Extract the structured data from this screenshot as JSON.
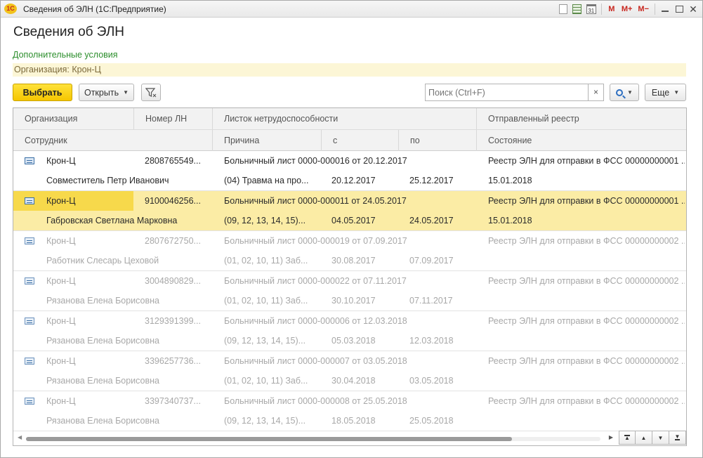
{
  "window": {
    "title": "Сведения об ЭЛН  (1С:Предприятие)",
    "logo_text": "1С",
    "calendar_day": "31",
    "memory_buttons": [
      "M",
      "M+",
      "M−"
    ]
  },
  "form": {
    "title": "Сведения об ЭЛН",
    "extra_conditions": "Дополнительные условия",
    "org_filter": "Организация: Крон-Ц"
  },
  "toolbar": {
    "select_label": "Выбрать",
    "open_label": "Открыть",
    "more_label": "Еще",
    "clear_glyph": "×"
  },
  "search": {
    "placeholder": "Поиск (Ctrl+F)",
    "value": ""
  },
  "table": {
    "header_row1": [
      "Организация",
      "Номер ЛН",
      "Листок нетрудоспособности",
      "Отправленный реестр"
    ],
    "header_row2": [
      "Сотрудник",
      "Причина",
      "с",
      "по",
      "Состояние"
    ],
    "rows": [
      {
        "org": "Крон-Ц",
        "number": "2808765549...",
        "sheet": "Больничный лист 0000-000016 от 20.12.2017",
        "registry": "Реестр ЭЛН для отправки в ФСС 00000000001 ...",
        "employee": "Совместитель Петр Иванович",
        "reason": "(04) Травма на про...",
        "from": "20.12.2017",
        "to": "25.12.2017",
        "state": "15.01.2018",
        "status": "active"
      },
      {
        "org": "Крон-Ц",
        "number": "9100046256...",
        "sheet": "Больничный лист 0000-000011 от 24.05.2017",
        "registry": "Реестр ЭЛН для отправки в ФСС 00000000001 ...",
        "employee": "Габровская Светлана Марковна",
        "reason": "(09, 12, 13, 14, 15)...",
        "from": "04.05.2017",
        "to": "24.05.2017",
        "state": "15.01.2018",
        "status": "selected"
      },
      {
        "org": "Крон-Ц",
        "number": "2807672750...",
        "sheet": "Больничный лист 0000-000019 от 07.09.2017",
        "registry": "Реестр ЭЛН для отправки в ФСС 00000000002 ...",
        "employee": "Работник Слесарь Цеховой",
        "reason": "(01, 02, 10, 11) Заб...",
        "from": "30.08.2017",
        "to": "07.09.2017",
        "state": "",
        "status": "dim"
      },
      {
        "org": "Крон-Ц",
        "number": "3004890829...",
        "sheet": "Больничный лист 0000-000022 от 07.11.2017",
        "registry": "Реестр ЭЛН для отправки в ФСС 00000000002 ...",
        "employee": "Рязанова Елена Борисовна",
        "reason": "(01, 02, 10, 11) Заб...",
        "from": "30.10.2017",
        "to": "07.11.2017",
        "state": "",
        "status": "dim"
      },
      {
        "org": "Крон-Ц",
        "number": "3129391399...",
        "sheet": "Больничный лист 0000-000006 от 12.03.2018",
        "registry": "Реестр ЭЛН для отправки в ФСС 00000000002 ...",
        "employee": "Рязанова Елена Борисовна",
        "reason": "(09, 12, 13, 14, 15)...",
        "from": "05.03.2018",
        "to": "12.03.2018",
        "state": "",
        "status": "dim"
      },
      {
        "org": "Крон-Ц",
        "number": "3396257736...",
        "sheet": "Больничный лист 0000-000007 от 03.05.2018",
        "registry": "Реестр ЭЛН для отправки в ФСС 00000000002 ...",
        "employee": "Рязанова Елена Борисовна",
        "reason": "(01, 02, 10, 11) Заб...",
        "from": "30.04.2018",
        "to": "03.05.2018",
        "state": "",
        "status": "dim"
      },
      {
        "org": "Крон-Ц",
        "number": "3397340737...",
        "sheet": "Больничный лист 0000-000008 от 25.05.2018",
        "registry": "Реестр ЭЛН для отправки в ФСС 00000000002 ...",
        "employee": "Рязанова Елена Борисовна",
        "reason": "(09, 12, 13, 14, 15)...",
        "from": "18.05.2018",
        "to": "25.05.2018",
        "state": "",
        "status": "dim"
      }
    ]
  },
  "colors": {
    "accent_yellow": "#f5c600",
    "selected_row": "#fbeca5",
    "link_green": "#2c8e2c",
    "filter_bg": "#fcf6d6"
  }
}
